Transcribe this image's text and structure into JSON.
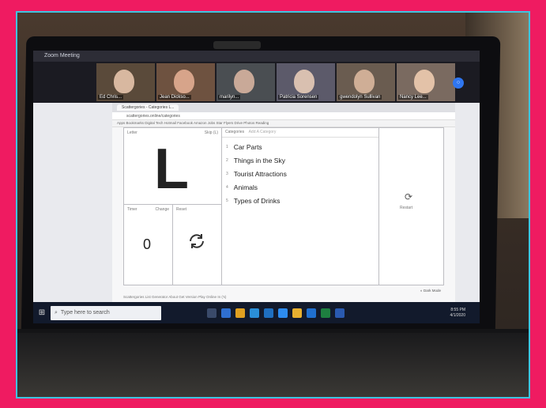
{
  "zoom": {
    "title": "Zoom Meeting",
    "participants": [
      "Ed Chris...",
      "Jean Dickso...",
      "marilyn...",
      "Patricia Sorensen",
      "gwendolyn Sullivan",
      "Nancy Lee..."
    ]
  },
  "browser": {
    "tab_label": "Scattergories - Categories L...",
    "address": "scattergories.online/categories",
    "bookmarks": "Apps  Bookmarks  Digital Tech  Hotmail  Facebook  Amazon  Jobs  Star  Flyers  Drive  Photos  Reading"
  },
  "app": {
    "letter_label": "Letter",
    "letter_hint": "Skip (L)",
    "letter": "L",
    "categories_label": "Categories",
    "categories_hint": "Add A Category",
    "categories": [
      "Car Parts",
      "Things in the Sky",
      "Tourist Attractions",
      "Animals",
      "Types of Drinks"
    ],
    "timer_label": "Timer",
    "timer_change": "Change",
    "timer_value": "0",
    "reset_label": "Reset",
    "restart_label": "Restart",
    "footer": "Scattergories List Generator   About   Get Version   Play Online In ('s)",
    "dark_toggle": "Dark Mode"
  },
  "taskbar": {
    "search_placeholder": "Type here to search",
    "time": "8:55 PM",
    "date": "4/1/2020"
  },
  "colors": {
    "frame": "#ef1b61",
    "border": "#3fc3e0",
    "taskbar": "#121a2c"
  }
}
